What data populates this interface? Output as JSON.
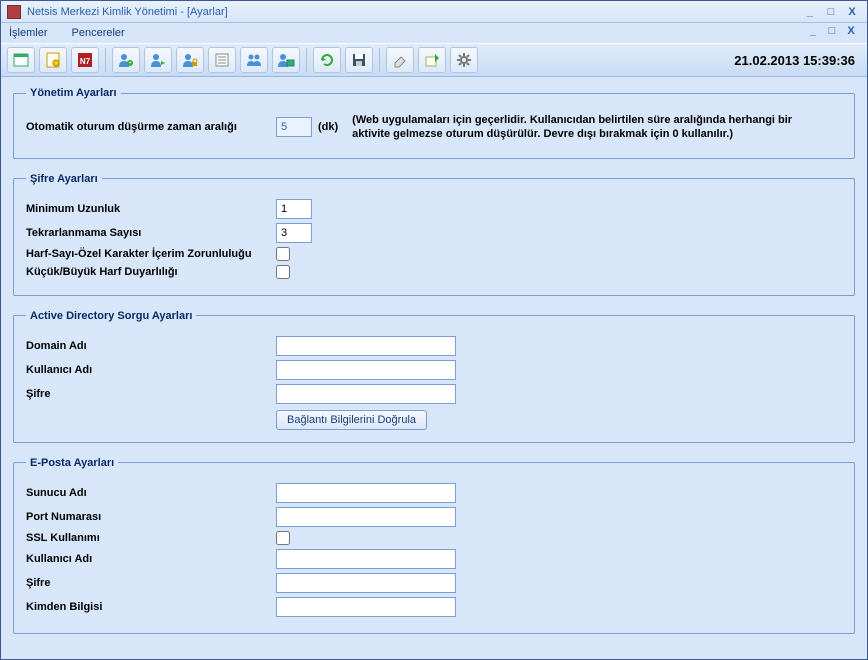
{
  "window": {
    "title": "Netsis Merkezi Kimlik Yönetimi - [Ayarlar]"
  },
  "menu": {
    "islemler": "İşlemler",
    "pencereler": "Pencereler"
  },
  "datetime": "21.02.2013 15:39:36",
  "groups": {
    "yonetim": {
      "legend": "Yönetim Ayarları",
      "timeout_label": "Otomatik oturum düşürme zaman aralığı",
      "timeout_value": "5",
      "timeout_unit": "(dk)",
      "timeout_hint": "(Web uygulamaları için geçerlidir. Kullanıcıdan belirtilen süre aralığında herhangi bir aktivite gelmezse oturum düşürülür. Devre dışı bırakmak için 0 kullanılır.)"
    },
    "sifre": {
      "legend": "Şifre Ayarları",
      "min_length_label": "Minimum Uzunluk",
      "min_length_value": "1",
      "no_repeat_label": "Tekrarlanmama Sayısı",
      "no_repeat_value": "3",
      "complexity_label": "Harf-Sayı-Özel Karakter İçerim Zorunluluğu",
      "case_label": "Küçük/Büyük Harf Duyarlılığı"
    },
    "ad": {
      "legend": "Active Directory Sorgu Ayarları",
      "domain_label": "Domain Adı",
      "domain_value": "",
      "user_label": "Kullanıcı Adı",
      "user_value": "",
      "pass_label": "Şifre",
      "pass_value": "",
      "verify_btn": "Bağlantı Bilgilerini Doğrula"
    },
    "eposta": {
      "legend": "E-Posta Ayarları",
      "server_label": "Sunucu Adı",
      "server_value": "",
      "port_label": "Port Numarası",
      "port_value": "",
      "ssl_label": "SSL Kullanımı",
      "user_label": "Kullanıcı Adı",
      "user_value": "",
      "pass_label": "Şifre",
      "pass_value": "",
      "from_label": "Kimden Bilgisi",
      "from_value": ""
    }
  }
}
